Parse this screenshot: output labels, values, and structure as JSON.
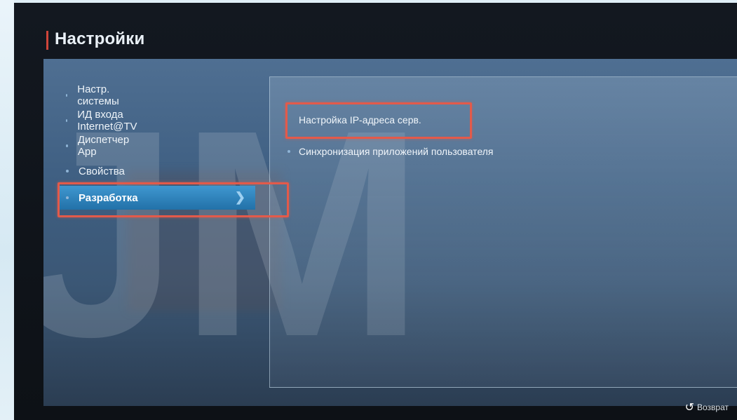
{
  "header": {
    "title": "Настройки"
  },
  "menu": {
    "items": [
      {
        "label": "Настр. системы"
      },
      {
        "label": "ИД входа Internet@TV"
      },
      {
        "label": "Диспетчер App"
      },
      {
        "label": "Свойства"
      },
      {
        "label": "Разработка"
      }
    ]
  },
  "submenu": {
    "items": [
      {
        "label": "Настройка IP-адреса серв."
      },
      {
        "label": "Синхронизация приложений пользователя"
      }
    ]
  },
  "footer": {
    "back_label": "Возврат"
  },
  "colors": {
    "accent": "#3f97d0",
    "highlight": "#e35a4a",
    "title_accent": "#d0453a"
  }
}
